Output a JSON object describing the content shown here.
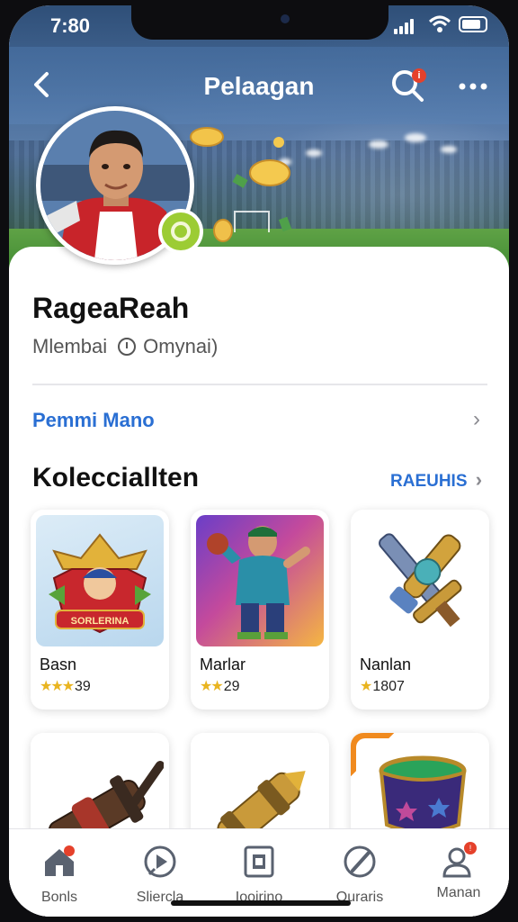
{
  "status_bar": {
    "time": "7:80"
  },
  "nav": {
    "title": "Pelaagan",
    "search_badge": "i"
  },
  "profile": {
    "name": "RageaReah",
    "member_label": "Mlembai",
    "member_status": "Omynai)"
  },
  "link_row": {
    "label": "Pemmi Mano"
  },
  "collection": {
    "title": "Kolecciallten",
    "see_all": "RAEUHIS",
    "items": [
      {
        "name": "Basn",
        "stars": "★★★",
        "rating": "39",
        "badge_text": "SORLERINA"
      },
      {
        "name": "Marlar",
        "stars": "★★",
        "rating": "29"
      },
      {
        "name": "Nanlan",
        "stars": "★",
        "rating": "1807"
      },
      {
        "name": "",
        "stars": "",
        "rating": ""
      },
      {
        "name": "",
        "stars": "",
        "rating": ""
      },
      {
        "name": "",
        "stars": "",
        "rating": ""
      }
    ]
  },
  "tabs": [
    {
      "label": "Bonls",
      "icon": "home-icon"
    },
    {
      "label": "Sliercla",
      "icon": "play-icon"
    },
    {
      "label": "Iooirino",
      "icon": "document-icon"
    },
    {
      "label": "Ouraris",
      "icon": "compass-icon"
    },
    {
      "label": "Manan",
      "icon": "profile-icon",
      "badge": "!"
    }
  ],
  "colors": {
    "accent_blue": "#2a6fd3",
    "badge_red": "#e5412b",
    "star_gold": "#e9b41f",
    "avatar_badge_green": "#9ccc34",
    "ribbon_orange": "#f08a1e"
  }
}
